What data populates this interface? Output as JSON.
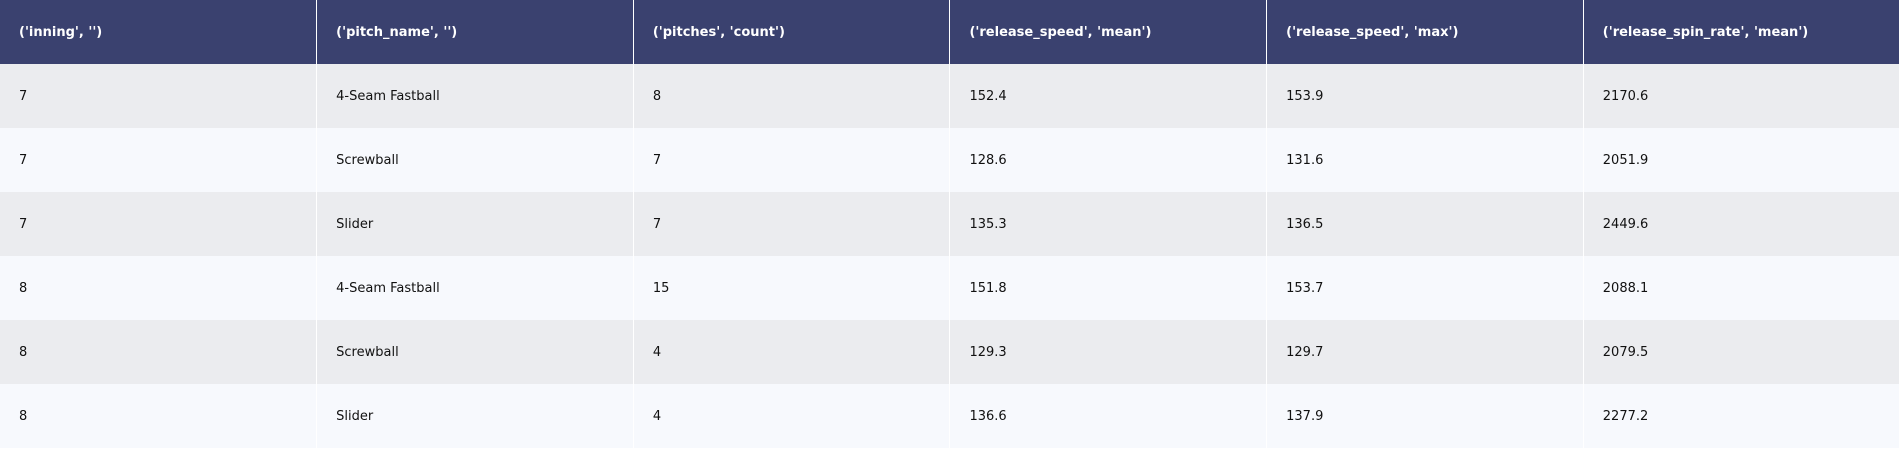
{
  "table": {
    "columns": [
      "('inning', '')",
      "('pitch_name', '')",
      "('pitches', 'count')",
      "('release_speed', 'mean')",
      "('release_speed', 'max')",
      "('release_spin_rate', 'mean')"
    ],
    "rows": [
      [
        "7",
        "4-Seam Fastball",
        "8",
        "152.4",
        "153.9",
        "2170.6"
      ],
      [
        "7",
        "Screwball",
        "7",
        "128.6",
        "131.6",
        "2051.9"
      ],
      [
        "7",
        "Slider",
        "7",
        "135.3",
        "136.5",
        "2449.6"
      ],
      [
        "8",
        "4-Seam Fastball",
        "15",
        "151.8",
        "153.7",
        "2088.1"
      ],
      [
        "8",
        "Screwball",
        "4",
        "129.3",
        "129.7",
        "2079.5"
      ],
      [
        "8",
        "Slider",
        "4",
        "136.6",
        "137.9",
        "2277.2"
      ]
    ]
  },
  "colors": {
    "header_bg": "#3a416f",
    "header_text": "#ffffff",
    "row_odd_bg": "#ebecef",
    "row_even_bg": "#f7f9fd",
    "body_text": "#111111"
  }
}
